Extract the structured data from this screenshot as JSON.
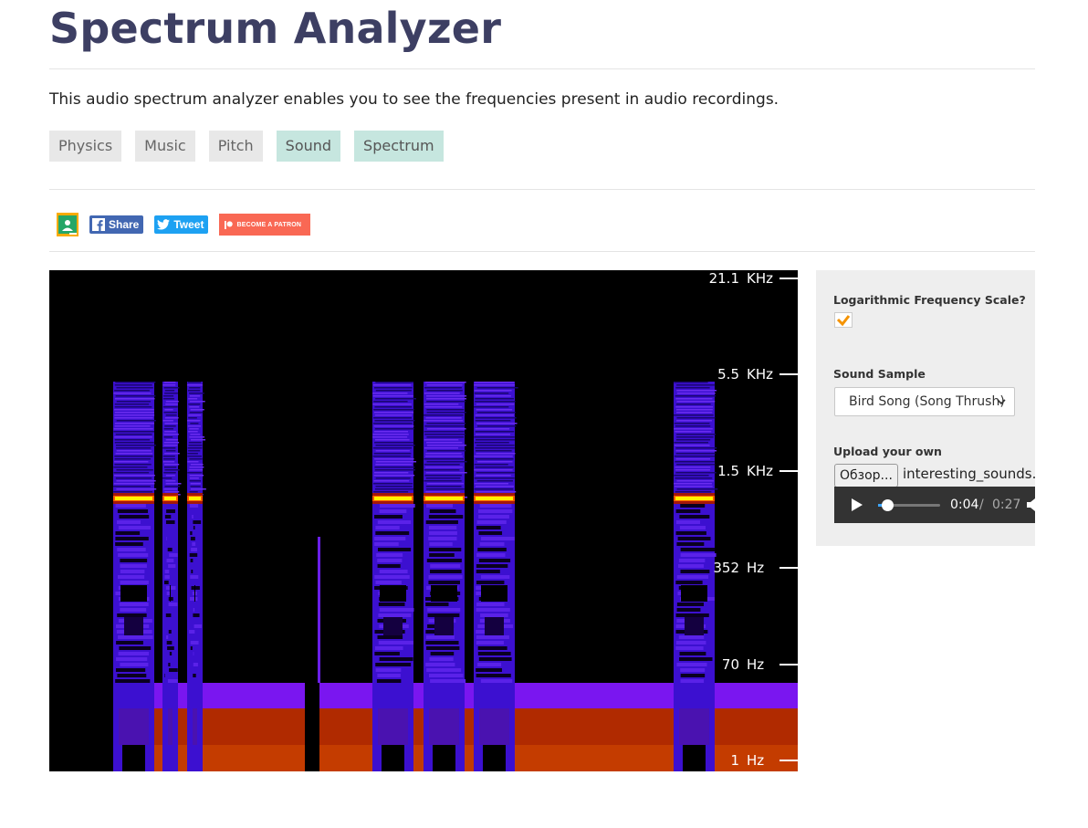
{
  "page": {
    "title": "Spectrum Analyzer",
    "description": "This audio spectrum analyzer enables you to see the frequencies present in audio recordings."
  },
  "tags": [
    {
      "label": "Physics",
      "active": false
    },
    {
      "label": "Music",
      "active": false
    },
    {
      "label": "Pitch",
      "active": false
    },
    {
      "label": "Sound",
      "active": true
    },
    {
      "label": "Spectrum",
      "active": true
    }
  ],
  "social": {
    "classroom_icon": "google-classroom-icon",
    "share_label": "Share",
    "tweet_label": "Tweet",
    "patron_label": "BECOME A PATRON",
    "colors": {
      "facebook": "#4267b2",
      "twitter": "#1da1f2",
      "patreon": "#f96854"
    }
  },
  "spectrogram": {
    "axis_labels": [
      {
        "value": "21.1",
        "unit": "KHz"
      },
      {
        "value": "5.5",
        "unit": "KHz"
      },
      {
        "value": "1.5",
        "unit": "KHz"
      },
      {
        "value": "352",
        "unit": "Hz"
      },
      {
        "value": "70",
        "unit": "Hz"
      },
      {
        "value": "1",
        "unit": "Hz"
      }
    ],
    "colors": {
      "background": "#000000",
      "low": "#3a0fd8",
      "mid": "#6a1fe8",
      "high": "#c03a00",
      "peak": "#fff200"
    }
  },
  "panel": {
    "log_scale_label": "Logarithmic Frequency Scale?",
    "log_scale_checked": true,
    "sound_sample_label": "Sound Sample",
    "sound_sample_value": "Bird Song (Song Thrush)",
    "upload_label": "Upload your own",
    "file_button": "Обзор...",
    "file_name": "interesting_sounds.",
    "audio": {
      "current_time": "0:04",
      "separator": "/",
      "total_time": "0:27",
      "progress": 0.148
    }
  }
}
